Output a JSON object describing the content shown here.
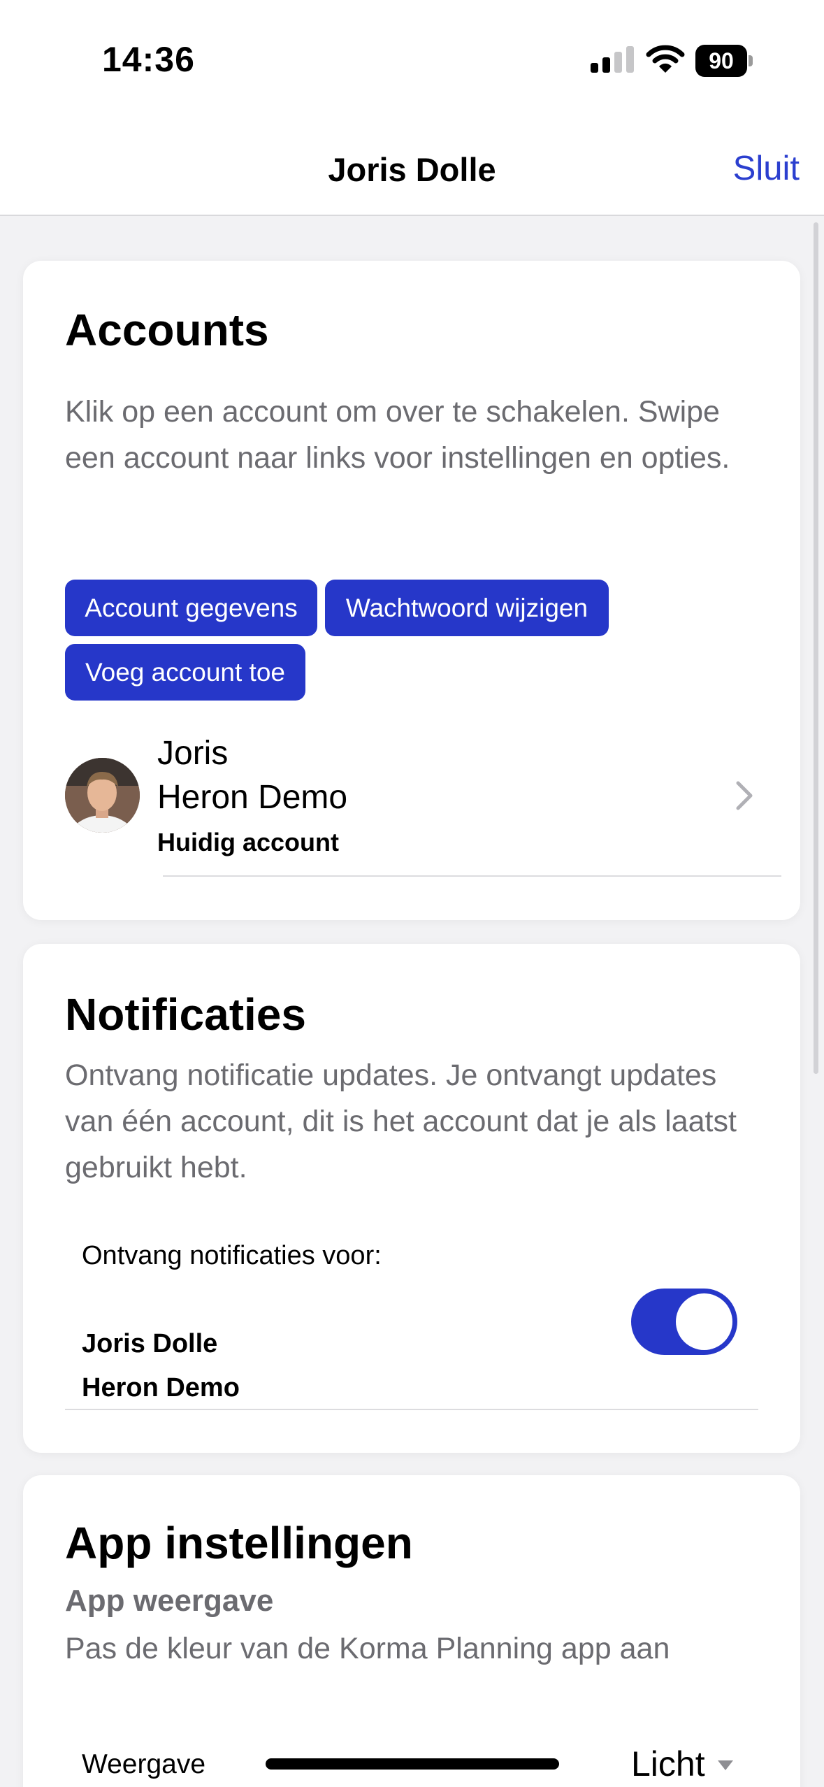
{
  "status_bar": {
    "time": "14:36",
    "battery": "90",
    "icons": [
      "signal-icon",
      "wifi-icon",
      "battery-icon"
    ]
  },
  "nav": {
    "title": "Joris Dolle",
    "close_label": "Sluit"
  },
  "accounts": {
    "title": "Accounts",
    "description": "Klik op een account om over te schakelen. Swipe een account naar links voor instellingen en opties.",
    "buttons": {
      "details": "Account gegevens",
      "change_password": "Wachtwoord wijzigen",
      "add_account": "Voeg account toe"
    },
    "current": {
      "name_line1": "Joris",
      "name_line2": "Heron Demo",
      "status": "Huidig account"
    }
  },
  "notifications": {
    "title": "Notificaties",
    "description": "Ontvang notificatie updates. Je ontvangt updates van één account, dit is het account dat je als laatst gebruikt hebt.",
    "receive_label": "Ontvang notificaties voor:",
    "account_name": "Joris Dolle",
    "account_org": "Heron Demo",
    "enabled": true
  },
  "app_settings": {
    "title": "App instellingen",
    "subtitle": "App weergave",
    "description": "Pas de kleur van de Korma Planning app aan",
    "appearance_label": "Weergave",
    "appearance_value": "Licht"
  },
  "colors": {
    "accent": "#2637c9",
    "link": "#2b3fcf",
    "muted_text": "#6b6b70",
    "background": "#f2f2f4"
  }
}
